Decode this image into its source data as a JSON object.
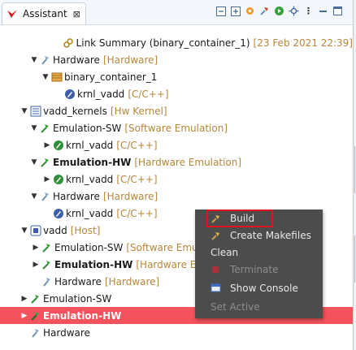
{
  "view": {
    "tab_title": "Assistant",
    "toolbar_icons": [
      "collapse-all-icon",
      "expand-all-icon",
      "settings-gear-icon",
      "build-hammer-icon",
      "run-icon",
      "debug-settings-icon",
      "view-menu-icon",
      "minimize-icon",
      "maximize-icon"
    ]
  },
  "tree": [
    {
      "label": "Link Summary (binary_container_1)",
      "decoration": "[23 Feb 2021 22:39]",
      "icon": "link-summary-icon"
    },
    {
      "label": "Hardware",
      "decoration": "[Hardware]",
      "icon": "hardware-build-icon"
    },
    {
      "label": "binary_container_1",
      "decoration": "",
      "icon": "binary-container-icon"
    },
    {
      "label": "krnl_vadd",
      "decoration": "[C/C++]",
      "icon": "kernel-icon"
    },
    {
      "label": "vadd_kernels",
      "decoration": "[Hw Kernel]",
      "icon": "hw-kernel-project-icon"
    },
    {
      "label": "Emulation-SW",
      "decoration": "[Software Emulation]",
      "icon": "emulation-build-icon"
    },
    {
      "label": "krnl_vadd",
      "decoration": "[C/C++]",
      "icon": "kernel-icon"
    },
    {
      "label": "Emulation-HW",
      "decoration": "[Hardware Emulation]",
      "icon": "emulation-build-icon"
    },
    {
      "label": "krnl_vadd",
      "decoration": "[C/C++]",
      "icon": "kernel-icon"
    },
    {
      "label": "Hardware",
      "decoration": "[Hardware]",
      "icon": "hardware-build-icon"
    },
    {
      "label": "krnl_vadd",
      "decoration": "[C/C++]",
      "icon": "kernel-icon"
    },
    {
      "label": "vadd",
      "decoration": "[Host]",
      "icon": "host-project-icon"
    },
    {
      "label": "Emulation-SW",
      "decoration": "[Software Emul",
      "icon": "emulation-build-icon"
    },
    {
      "label": "Emulation-HW",
      "decoration": "[Hardware Er",
      "icon": "emulation-build-icon"
    },
    {
      "label": "Hardware",
      "decoration": "[Hardware]",
      "icon": "hardware-build-icon"
    },
    {
      "label": "Emulation-SW",
      "decoration": "",
      "icon": "emulation-build-icon"
    },
    {
      "label": "Emulation-HW",
      "decoration": "",
      "icon": "emulation-build-icon"
    },
    {
      "label": "Hardware",
      "decoration": "",
      "icon": "hardware-build-icon"
    }
  ],
  "context_menu": {
    "items": [
      {
        "label": "Build",
        "enabled": true,
        "icon": "build-hammer-icon"
      },
      {
        "label": "Create Makefiles",
        "enabled": true,
        "icon": "create-makefiles-icon"
      },
      {
        "label": "Clean",
        "enabled": true,
        "icon": ""
      },
      {
        "label": "Terminate",
        "enabled": false,
        "icon": "terminate-icon"
      },
      {
        "label": "Show Console",
        "enabled": true,
        "icon": "show-console-icon"
      },
      {
        "label": "Set Active",
        "enabled": false,
        "icon": ""
      }
    ]
  },
  "colors": {
    "selection": "#f4525c",
    "decoration": "#b5873a",
    "menu_bg": "#4c4c4c",
    "highlight_box": "#e0141e"
  }
}
